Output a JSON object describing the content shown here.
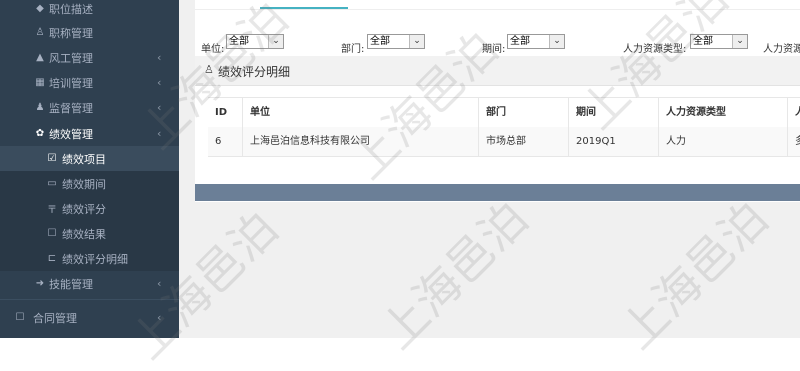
{
  "sidebar": {
    "items": [
      {
        "icon": "diamond-icon",
        "glyph": "◆",
        "label": "职位描述"
      },
      {
        "icon": "user-icon",
        "glyph": "♙",
        "label": "职称管理"
      },
      {
        "icon": "alert-icon",
        "glyph": "▲",
        "label": "风工管理",
        "chevron": "‹"
      },
      {
        "icon": "building-icon",
        "glyph": "▦",
        "label": "培训管理",
        "chevron": "‹"
      },
      {
        "icon": "supervise-icon",
        "glyph": "♟",
        "label": "监督管理",
        "chevron": "‹"
      },
      {
        "icon": "settings-icon",
        "glyph": "✿",
        "label": "绩效管理",
        "chevron": "‹"
      }
    ],
    "subitems": [
      {
        "icon": "check-icon",
        "glyph": "☑",
        "label": "绩效项目"
      },
      {
        "icon": "period-icon",
        "glyph": "▭",
        "label": "绩效期间"
      },
      {
        "icon": "rating-icon",
        "glyph": "〒",
        "label": "绩效评分"
      },
      {
        "icon": "bookmark-icon",
        "glyph": "☐",
        "label": "绩效结果"
      },
      {
        "icon": "detail-icon",
        "glyph": "⊏",
        "label": "绩效评分明细"
      }
    ],
    "tech": {
      "icon": "tag-icon",
      "glyph": "➜",
      "label": "技能管理",
      "chevron": "‹"
    },
    "contract": {
      "icon": "contract-icon",
      "glyph": "☐",
      "label": "合同管理",
      "chevron": "‹"
    }
  },
  "filters": {
    "unit_label": "单位:",
    "unit_value": "全部",
    "dept_label": "部门:",
    "dept_value": "全部",
    "period_label": "期间:",
    "period_value": "全部",
    "hrtype_label": "人力资源类型:",
    "hrtype_value": "全部",
    "hr_more_label": "人力资源"
  },
  "section": {
    "title": "绩效评分明细"
  },
  "table": {
    "headers": [
      "ID",
      "单位",
      "部门",
      "期间",
      "人力资源类型",
      "人"
    ],
    "rows": [
      [
        "6",
        "上海邑泊信息科技有限公司",
        "市场总部",
        "2019Q1",
        "人力",
        "多"
      ]
    ]
  },
  "watermark": "上海邑泊",
  "colors": {
    "sidebar": "#2f4050",
    "accent": "#45b2c2",
    "bar": "#6b7f97"
  }
}
